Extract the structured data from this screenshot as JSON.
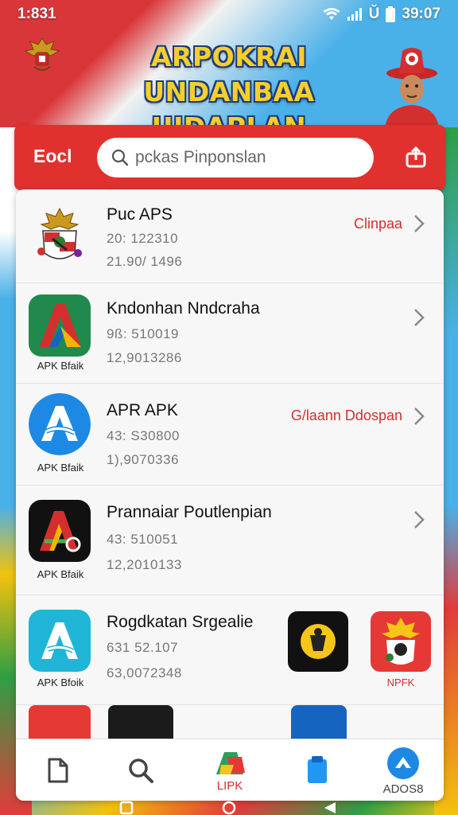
{
  "status_bar": {
    "time": "1:831",
    "right_text": "39:07",
    "battery_label": "Ŭ"
  },
  "hero": {
    "title_line1": "ARPOKRAI UNDANBAA",
    "title_line2": "UIDAPLAN UNIDINASI",
    "title_color": "#f6cf2c"
  },
  "header": {
    "label": "Eocl",
    "search_placeholder": "pckas Pinponslan",
    "accent": "#e0312f"
  },
  "apps": [
    {
      "name": "Puc APS",
      "meta1": "20: 122310",
      "meta2": "21.90/ 1496",
      "action": "Clinpaa",
      "icon": "garuda-emblem-icon",
      "caption": ""
    },
    {
      "name": "Kndonhan Nndcraha",
      "meta1": "9ß: 510019",
      "meta2": "12,9013286",
      "action": "",
      "icon": "green-a-icon",
      "caption": "APK Bfaik"
    },
    {
      "name": "APR APK",
      "meta1": "43: S30800",
      "meta2": "1),9070336",
      "action": "G/laann Ddospan",
      "icon": "blue-a-icon",
      "caption": "APK Bfaik"
    },
    {
      "name": "Prannaiar Poutlenpian",
      "meta1": "43: 510051",
      "meta2": "12,2010133",
      "action": "",
      "icon": "black-a-icon",
      "caption": "APK Bfaik"
    },
    {
      "name": "Rogdkatan Srgealie",
      "meta1": "631 52.107",
      "meta2": "63,0072348",
      "action": "",
      "icon": "teal-a-icon",
      "caption": "APK Bfoik"
    }
  ],
  "extra_icons": [
    {
      "icon": "yellow-badge-icon",
      "caption": ""
    },
    {
      "icon": "red-emblem-icon",
      "caption": "NPFK"
    }
  ],
  "bottom_nav": [
    {
      "icon": "file-icon",
      "label": ""
    },
    {
      "icon": "search-icon",
      "label": ""
    },
    {
      "icon": "lipk-logo-icon",
      "label": "LIPK"
    },
    {
      "icon": "bookmark-icon",
      "label": ""
    },
    {
      "icon": "share-arrow-icon",
      "label": "ADOS8"
    }
  ]
}
